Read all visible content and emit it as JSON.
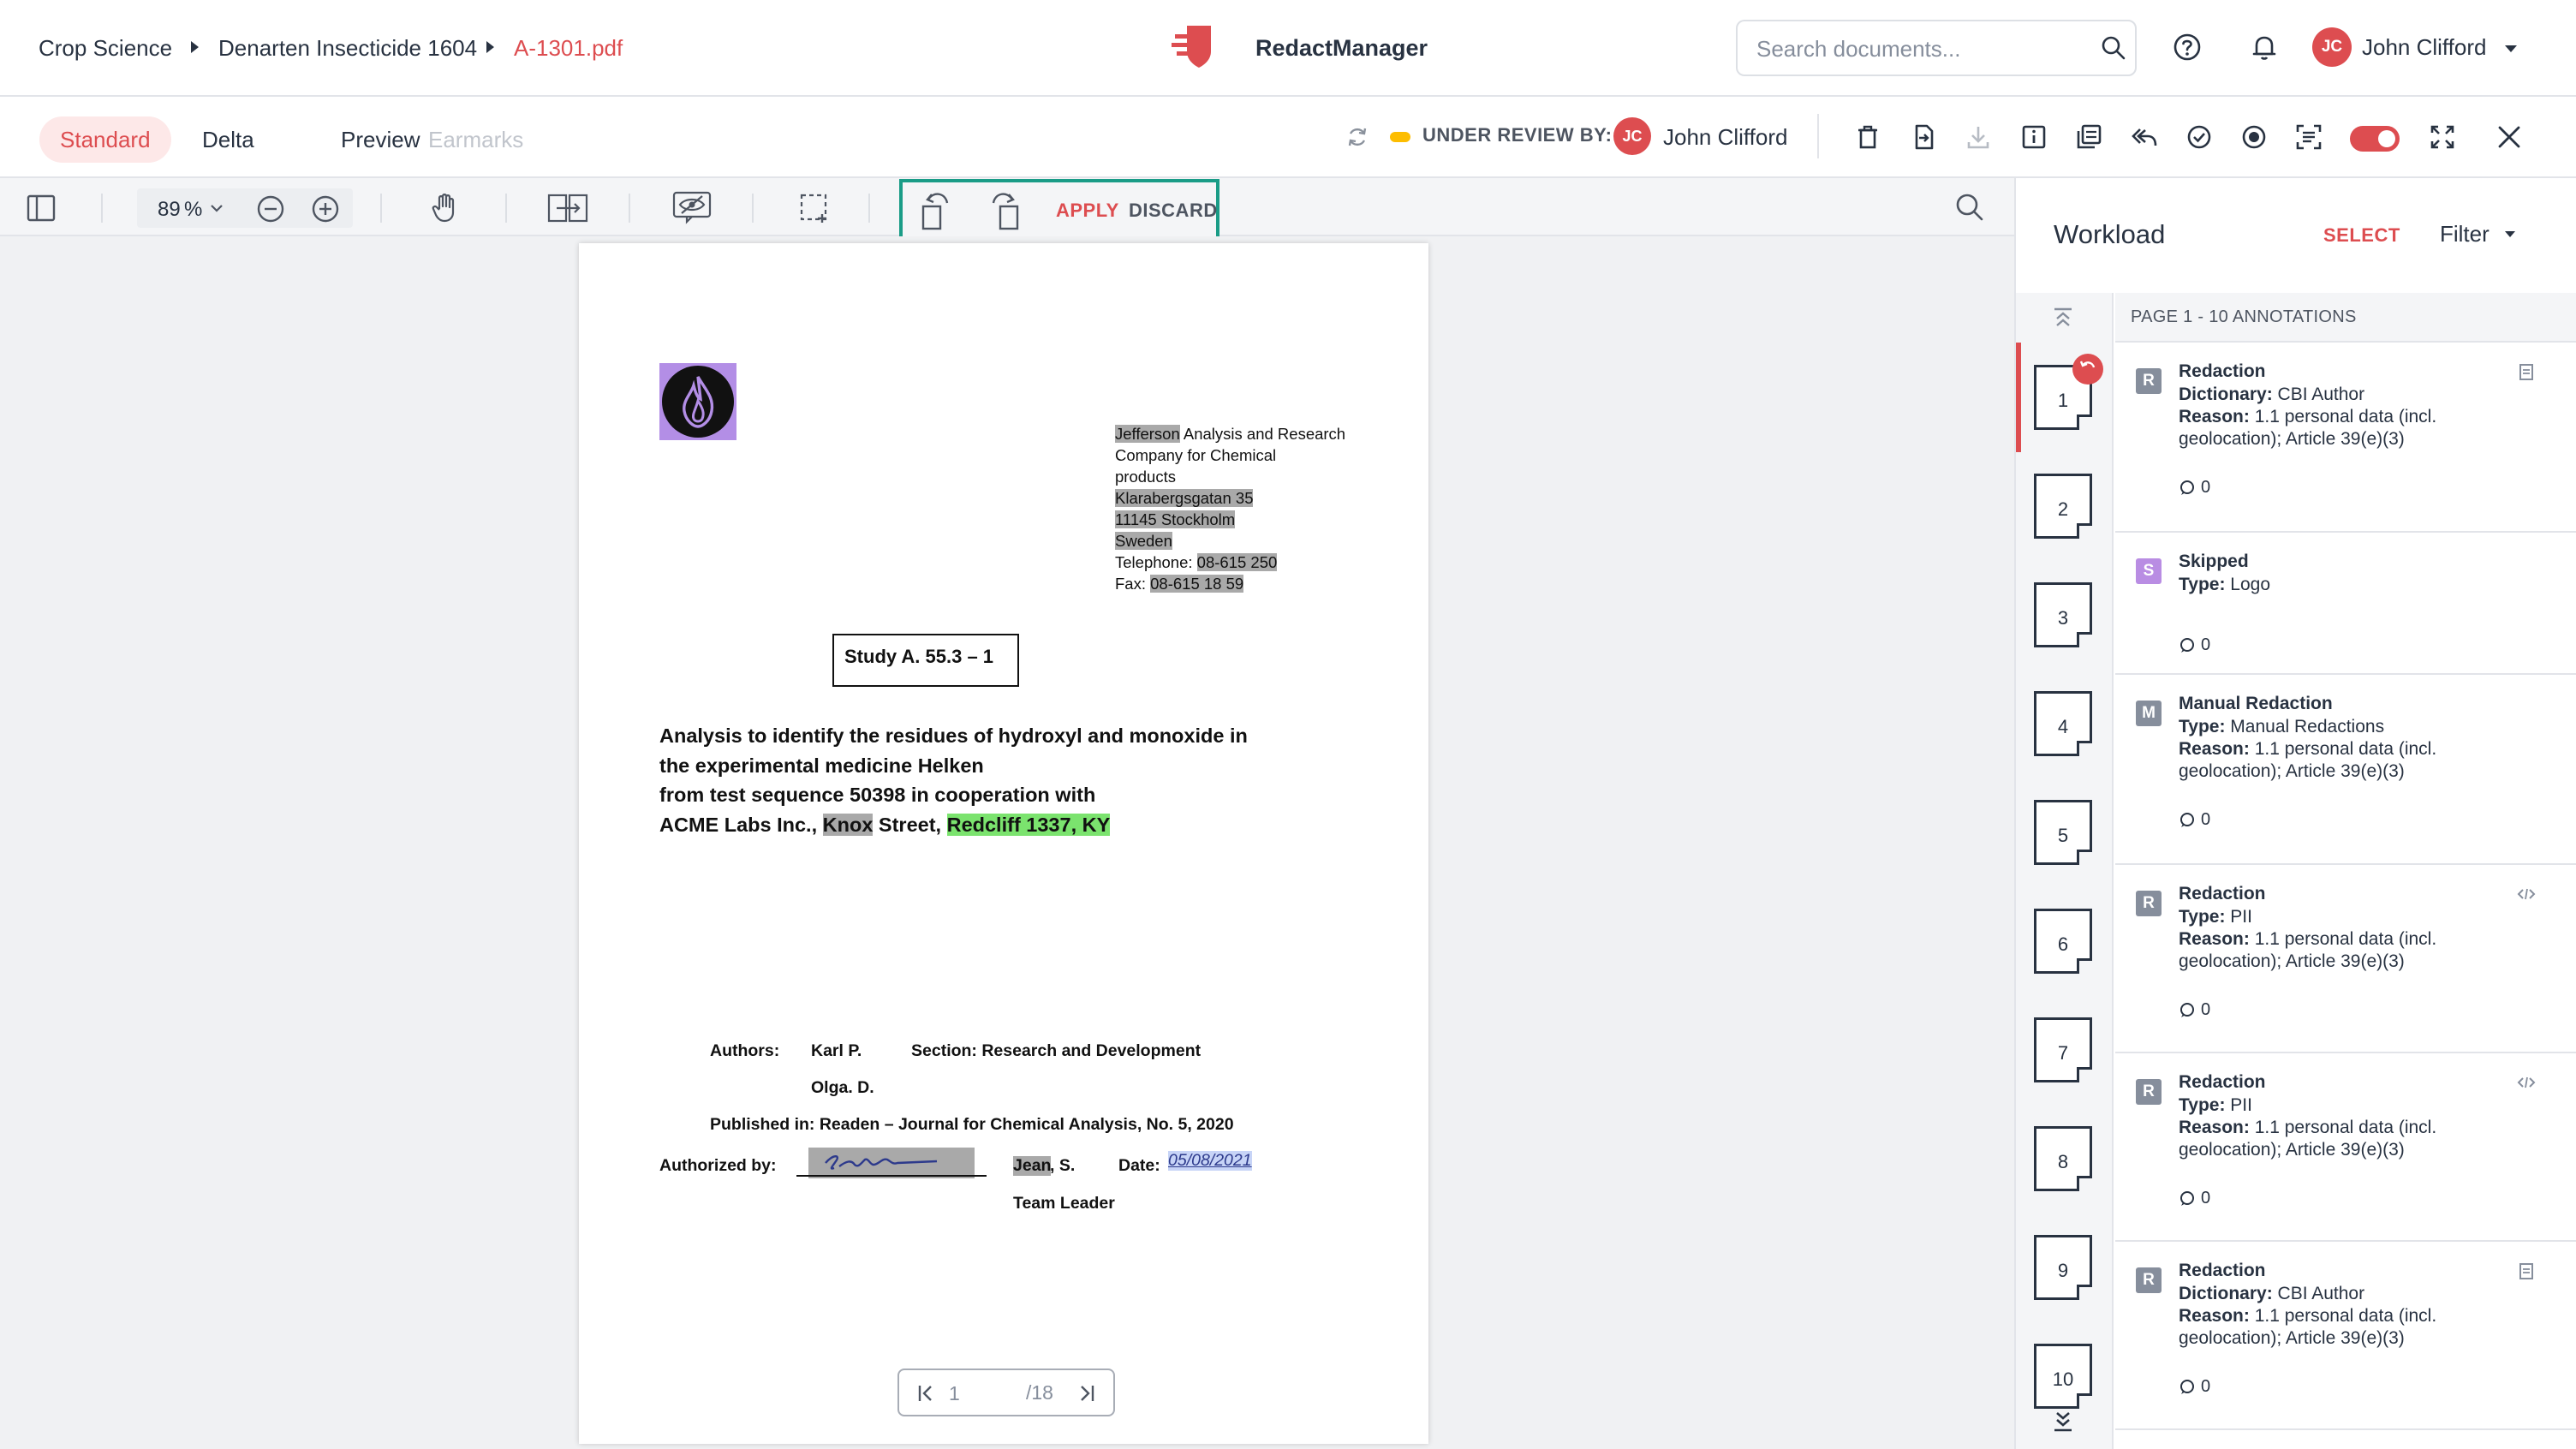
{
  "breadcrumb": {
    "items": [
      "Crop Science",
      "Denarten Insecticide 1604",
      "A-1301.pdf"
    ]
  },
  "app": {
    "name": "RedactManager"
  },
  "search": {
    "placeholder": "Search documents..."
  },
  "user": {
    "initials": "JC",
    "name": "John Clifford"
  },
  "tabs": [
    {
      "label": "Standard",
      "state": "active"
    },
    {
      "label": "Delta",
      "state": "normal"
    },
    {
      "label": "Preview",
      "state": "normal"
    },
    {
      "label": "Earmarks",
      "state": "disabled"
    }
  ],
  "review": {
    "label": "UNDER REVIEW BY:",
    "initials": "JC",
    "name": "John Clifford",
    "status_color": "#fdbd00"
  },
  "viewer": {
    "zoom": "89",
    "zoom_unit": "%",
    "apply_label": "APPLY",
    "discard_label": "DISCARD"
  },
  "pager": {
    "current": "1",
    "total": "/18"
  },
  "document": {
    "company_lines": [
      {
        "parts": [
          {
            "text": "Jefferson",
            "hl": "gray"
          },
          {
            "text": " Analysis and Research",
            "hl": ""
          }
        ]
      },
      {
        "parts": [
          {
            "text": "Company for Chemical",
            "hl": ""
          }
        ]
      },
      {
        "parts": [
          {
            "text": "products",
            "hl": ""
          }
        ]
      },
      {
        "parts": [
          {
            "text": "Klarabergsgatan 35",
            "hl": "gray"
          }
        ]
      },
      {
        "parts": [
          {
            "text": "11145 Stockholm",
            "hl": "gray"
          }
        ]
      },
      {
        "parts": [
          {
            "text": "Sweden",
            "hl": "gray"
          }
        ]
      },
      {
        "parts": [
          {
            "text": "Telephone: ",
            "hl": ""
          },
          {
            "text": "08-615 250",
            "hl": "gray"
          }
        ]
      },
      {
        "parts": [
          {
            "text": "Fax: ",
            "hl": ""
          },
          {
            "text": "08-615 18 59",
            "hl": "gray"
          }
        ]
      }
    ],
    "study_title": "Study A. 55.3 – 1",
    "heading_lines": [
      {
        "parts": [
          {
            "text": "Analysis to identify the residues of hydroxyl and monoxide in",
            "hl": ""
          }
        ]
      },
      {
        "parts": [
          {
            "text": "the experimental medicine Helken",
            "hl": ""
          }
        ]
      },
      {
        "parts": [
          {
            "text": "from test sequence 50398 in cooperation with",
            "hl": ""
          }
        ]
      },
      {
        "parts": [
          {
            "text": "ACME Labs Inc., ",
            "hl": ""
          },
          {
            "text": "Knox",
            "hl": "gray"
          },
          {
            "text": " Street, ",
            "hl": ""
          },
          {
            "text": "Redcliff 1337, KY",
            "hl": "green"
          }
        ]
      }
    ],
    "authors_label": "Authors:",
    "author1": "Karl P.",
    "author2": "Olga. D.",
    "section": "Section: Research and Development",
    "published": "Published in: Readen – Journal for Chemical Analysis, No. 5, 2020",
    "authorized_label": "Authorized by:",
    "signer_name": "Jean",
    "signer_suffix": ", S.",
    "date_label": "Date:",
    "date_value": "05/08/2021",
    "signer_title": "Team Leader"
  },
  "workload": {
    "title": "Workload",
    "select_label": "SELECT",
    "filter_label": "Filter",
    "list_header": "PAGE 1 - 10 ANNOTATIONS",
    "pages": [
      "1",
      "2",
      "3",
      "4",
      "5",
      "6",
      "7",
      "8",
      "9",
      "10"
    ],
    "annotations": [
      {
        "badge": "R",
        "badge_color": "#868e9c",
        "title": "Redaction",
        "k1": "Dictionary:",
        "v1": "CBI Author",
        "k2": "Reason:",
        "v2": "1.1 personal data (incl. geolocation); Article 39(e)(3)",
        "comments": "0",
        "action_icon": "clipboard-icon"
      },
      {
        "badge": "S",
        "badge_color": "#b98de3",
        "title": "Skipped",
        "k1": "Type:",
        "v1": "Logo",
        "k2": "",
        "v2": "",
        "comments": "0",
        "action_icon": ""
      },
      {
        "badge": "M",
        "badge_color": "#868e9c",
        "title": "Manual Redaction",
        "k1": "Type:",
        "v1": "Manual Redactions",
        "k2": "Reason:",
        "v2": "1.1 personal data (incl. geolocation); Article 39(e)(3)",
        "comments": "0",
        "action_icon": ""
      },
      {
        "badge": "R",
        "badge_color": "#868e9c",
        "title": "Redaction",
        "k1": "Type:",
        "v1": "PII",
        "k2": "Reason:",
        "v2": "1.1 personal data (incl. geolocation); Article 39(e)(3)",
        "comments": "0",
        "action_icon": "code-icon"
      },
      {
        "badge": "R",
        "badge_color": "#868e9c",
        "title": "Redaction",
        "k1": "Type:",
        "v1": "PII",
        "k2": "Reason:",
        "v2": "1.1 personal data (incl. geolocation); Article 39(e)(3)",
        "comments": "0",
        "action_icon": "code-icon"
      },
      {
        "badge": "R",
        "badge_color": "#868e9c",
        "title": "Redaction",
        "k1": "Dictionary:",
        "v1": "CBI Author",
        "k2": "Reason:",
        "v2": "1.1 personal data (incl. geolocation); Article 39(e)(3)",
        "comments": "0",
        "action_icon": "clipboard-icon"
      }
    ]
  },
  "colors": {
    "accent": "#dd4d50",
    "teal": "#1a9c87",
    "text": "#283241"
  }
}
